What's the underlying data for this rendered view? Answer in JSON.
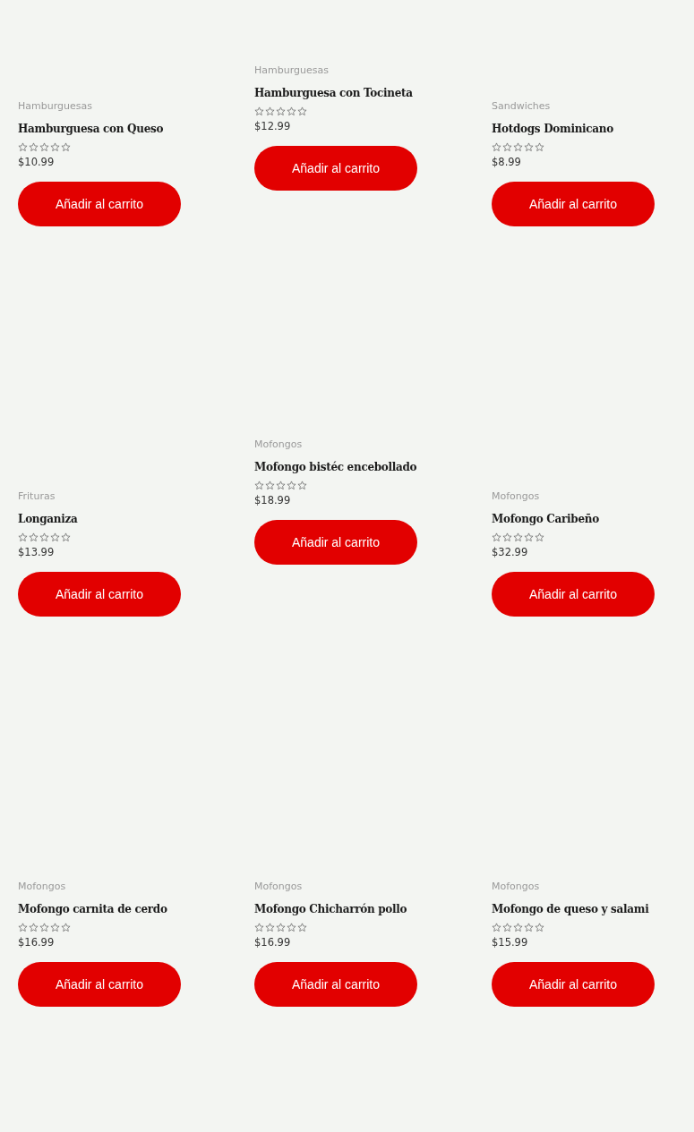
{
  "products": [
    {
      "category": "Hamburguesas",
      "name": "Hamburguesa con Queso",
      "stars": 0,
      "price": "$10.99",
      "button": "Añadir al carrito"
    },
    {
      "category": "Hamburguesas",
      "name": "Hamburguesa con Tocineta",
      "stars": 0,
      "price": "$12.99",
      "button": "Añadir al carrito"
    },
    {
      "category": "Sandwiches",
      "name": "Hotdogs Dominicano",
      "stars": 0,
      "price": "$8.99",
      "button": "Añadir al carrito"
    },
    {
      "category": "Frituras",
      "name": "Longaniza",
      "stars": 0,
      "price": "$13.99",
      "button": "Añadir al carrito"
    },
    {
      "category": "Mofongos",
      "name": "Mofongo bistéc encebollado",
      "stars": 0,
      "price": "$18.99",
      "button": "Añadir al carrito"
    },
    {
      "category": "Mofongos",
      "name": "Mofongo Caribeño",
      "stars": 0,
      "price": "$32.99",
      "button": "Añadir al carrito"
    },
    {
      "category": "Mofongos",
      "name": "Mofongo carnita de cerdo",
      "stars": 0,
      "price": "$16.99",
      "button": "Añadir al carrito"
    },
    {
      "category": "Mofongos",
      "name": "Mofongo Chicharrón pollo",
      "stars": 0,
      "price": "$16.99",
      "button": "Añadir al carrito"
    },
    {
      "category": "Mofongos",
      "name": "Mofongo de queso y salami",
      "stars": 0,
      "price": "$15.99",
      "button": "Añadir al carrito"
    }
  ]
}
